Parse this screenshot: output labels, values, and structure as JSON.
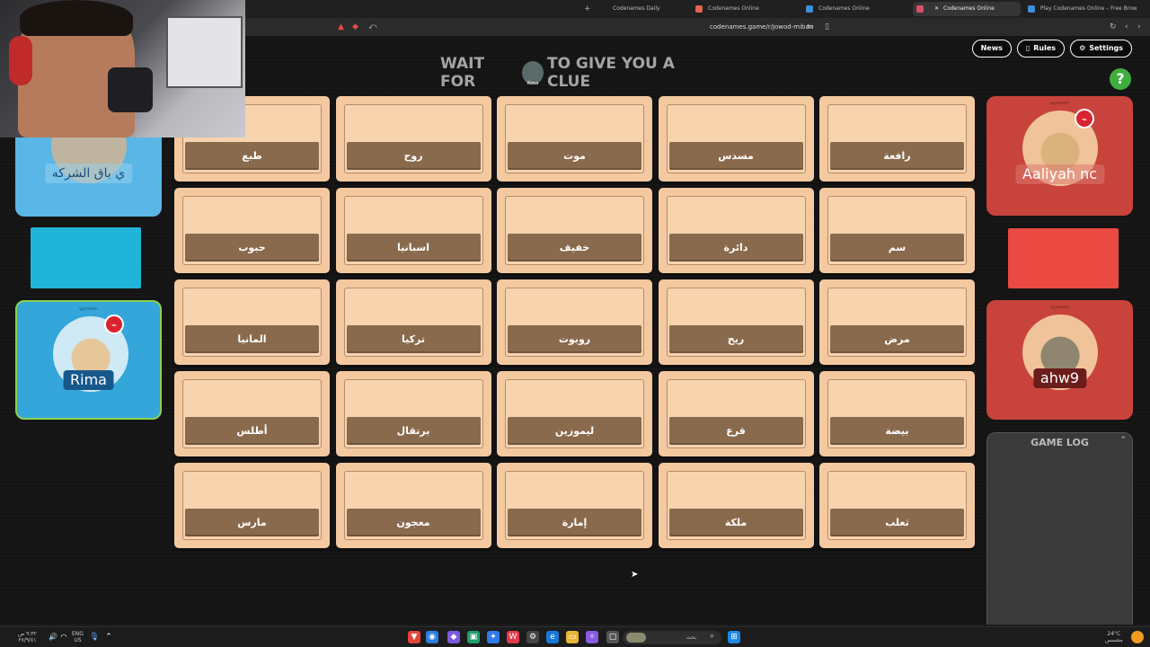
{
  "browser": {
    "tabs": [
      {
        "title": "Codenames Daily",
        "icon_color": "#3d6bd9"
      },
      {
        "title": "Codenames Online",
        "icon_color": "#e2664f"
      },
      {
        "title": "Codenames Online",
        "icon_color": "#3d8fd9"
      },
      {
        "title": "Codenames Online",
        "icon_color": "#d94f6a"
      },
      {
        "title": "Play Codenames Online – Free Brow",
        "icon_color": "#3d8fd9"
      }
    ],
    "new_tab_glyph": "+",
    "close_glyph": "✕",
    "url": "codenames.game/r/jowod-miban"
  },
  "game": {
    "nav": {
      "news": "News",
      "rules": "Rules",
      "settings": "Settings"
    },
    "help_glyph": "?",
    "banner": {
      "prefix": "WAIT FOR",
      "suffix": "TO GIVE YOU A CLUE",
      "avatar_name": "Rima"
    },
    "cards": [
      "طبع",
      "روح",
      "موت",
      "مسدس",
      "رافعة",
      "حبوب",
      "اسبانيا",
      "خفيف",
      "دائرة",
      "سم",
      "المانيا",
      "تركيا",
      "روبوت",
      "ريح",
      "مرض",
      "أطلس",
      "برتقال",
      "ليموزين",
      "قرع",
      "بيضة",
      "مارس",
      "معجون",
      "إمارة",
      "ملكة",
      "ثعلب"
    ],
    "players": {
      "blue_top": {
        "name": "ي باق الشركه"
      },
      "rima": {
        "name": "Rima",
        "small": "spymaster"
      },
      "aaliyah": {
        "name": "Aaliyah nc",
        "small": "spymaster"
      },
      "ahw9": {
        "name": "ahw9",
        "small": "spymaster"
      }
    },
    "colors": {
      "blue_team": "#20b5d8",
      "red_team": "#ea4a42",
      "card": "#f4c9a0",
      "card_label": "#8a6a4d"
    },
    "game_log": {
      "title": "GAME LOG",
      "toggle": "⌃"
    }
  },
  "taskbar": {
    "lang": "ENG",
    "region": "US",
    "search_placeholder": "بحث",
    "weather_temp": "24°C",
    "weather_desc": "مشمس",
    "time": "٩:٣٢ ص",
    "date": "٢٧/٩/٤١"
  }
}
